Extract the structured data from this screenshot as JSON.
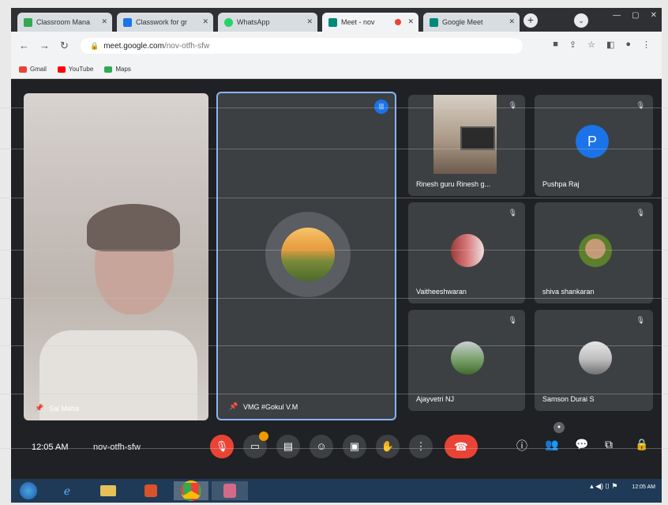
{
  "tabs": [
    {
      "label": "Classroom Mana",
      "color": "#34a853"
    },
    {
      "label": "Classwork for gr",
      "color": "#1a73e8"
    },
    {
      "label": "WhatsApp",
      "color": "#25d366"
    },
    {
      "label": "Meet - nov",
      "color": "#00897b"
    },
    {
      "label": "Google Meet",
      "color": "#00897b"
    }
  ],
  "address": {
    "domain": "meet.google.com",
    "path": "/nov-otfh-sfw"
  },
  "bookmarks": [
    {
      "label": "Gmail",
      "color": "#ea4335"
    },
    {
      "label": "YouTube",
      "color": "#ff0000"
    },
    {
      "label": "Maps",
      "color": "#34a853"
    }
  ],
  "participants": [
    {
      "name": "Rinesh guru Rinesh g..."
    },
    {
      "name": "Pushpa Raj",
      "initial": "P"
    },
    {
      "name": "Vaitheeshwaran"
    },
    {
      "name": "shiva shankaran"
    },
    {
      "name": "Ajayvetri NJ"
    },
    {
      "name": "Samson Durai S"
    }
  ],
  "pinned": {
    "name": "VMG #Gokul V.M"
  },
  "self_tile": {
    "name": "Sai Maha"
  },
  "meeting": {
    "time": "12:05 AM",
    "code": "nov-otfh-sfw"
  },
  "taskbar": {
    "time": "12:05 AM"
  },
  "colors": {
    "accent": "#8ab4f8",
    "hangup": "#ea4335",
    "avatar_blue": "#1a73e8"
  }
}
